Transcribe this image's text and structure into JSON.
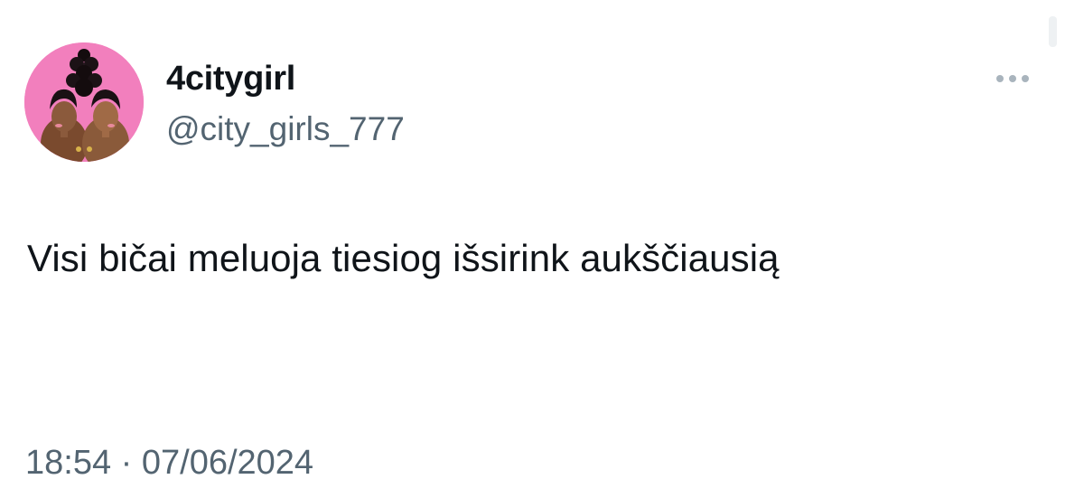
{
  "author": {
    "display_name": "4citygirl",
    "handle": "@city_girls_777",
    "avatar": {
      "icon": "profile-photo-icon",
      "background_color": "#f27fbd"
    }
  },
  "more_menu": {
    "icon": "more-options-icon"
  },
  "tweet": {
    "text": "Visi bičai meluoja tiesiog išsirink aukščiausią",
    "timestamp": "18:54 · 07/06/2024"
  },
  "colors": {
    "primary_text": "#0f1419",
    "secondary_text": "#536471",
    "icon_gray": "#a9b4bd"
  }
}
